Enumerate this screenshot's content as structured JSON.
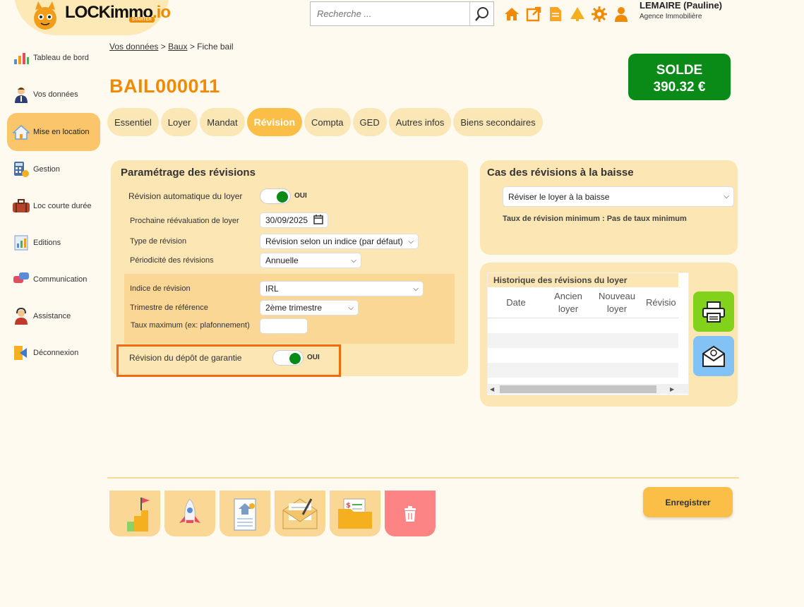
{
  "app": {
    "logo_text": "LOCKimmo",
    "logo_suffix": ".io",
    "logo_badge": "STARTER"
  },
  "search": {
    "placeholder": "Recherche ..."
  },
  "user": {
    "name": "LEMAIRE (Pauline)",
    "agency": "Agence Immobilière"
  },
  "top_icons": [
    "home-icon",
    "external-link-icon",
    "document-icon",
    "tree-icon",
    "gear-icon",
    "user-icon"
  ],
  "sidebar": {
    "items": [
      {
        "label": "Tableau de bord",
        "icon": "dashboard-icon"
      },
      {
        "label": "Vos données",
        "icon": "person-icon"
      },
      {
        "label": "Mise en location",
        "icon": "house-icon",
        "active": true
      },
      {
        "label": "Gestion",
        "icon": "calculator-icon"
      },
      {
        "label": "Loc courte durée",
        "icon": "suitcase-icon"
      },
      {
        "label": "Editions",
        "icon": "chart-icon"
      },
      {
        "label": "Communication",
        "icon": "chat-icon"
      },
      {
        "label": "Assistance",
        "icon": "support-icon"
      },
      {
        "label": "Déconnexion",
        "icon": "logout-icon"
      }
    ]
  },
  "breadcrumb": {
    "item1": "Vos données",
    "sep": ">",
    "item2": "Baux",
    "item3": "Fiche bail"
  },
  "page": {
    "title": "BAIL000011"
  },
  "solde": {
    "label": "SOLDE",
    "amount": "390.32 €"
  },
  "tabs": [
    "Essentiel",
    "Loyer",
    "Mandat",
    "Révision",
    "Compta",
    "GED",
    "Autres infos",
    "Biens secondaires"
  ],
  "active_tab": "Révision",
  "revisions": {
    "title": "Paramétrage des révisions",
    "auto_label": "Révision automatique du loyer",
    "auto_value": "OUI",
    "next_eval_label": "Prochaine réévaluation de loyer",
    "next_eval_value": "30/09/2025",
    "type_label": "Type de révision",
    "type_value": "Révision selon un indice (par défaut)",
    "period_label": "Périodicité des révisions",
    "period_value": "Annuelle",
    "index_label": "Indice de révision",
    "index_value": "IRL",
    "quarter_label": "Trimestre de référence",
    "quarter_value": "2ème trimestre",
    "max_rate_label": "Taux maximum (ex: plafonnement)",
    "max_rate_value": "",
    "deposit_label": "Révision du dépôt de garantie",
    "deposit_value": "OUI"
  },
  "baisse": {
    "title": "Cas des révisions à la baisse",
    "select_value": "Réviser le loyer à la baisse",
    "min_rate_text": "Taux de révision minimum : Pas de taux minimum"
  },
  "history": {
    "title": "Historique des révisions du loyer",
    "columns": [
      "Date",
      "Ancien loyer",
      "Nouveau loyer",
      "Révisio"
    ],
    "rows": []
  },
  "actions": {
    "save_label": "Enregistrer"
  },
  "colors": {
    "accent": "#f08a00",
    "solde_bg": "#0a8a16",
    "tab_active": "#fbbf48",
    "panel": "#fce6b4",
    "highlight": "#f06a10"
  }
}
